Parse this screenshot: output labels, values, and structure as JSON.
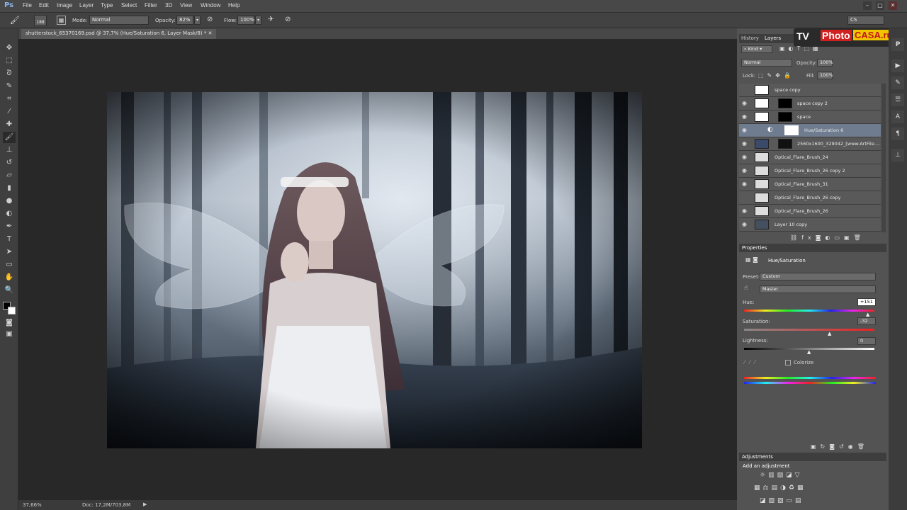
{
  "menubar": {
    "logo": "Ps",
    "items": [
      "File",
      "Edit",
      "Image",
      "Layer",
      "Type",
      "Select",
      "Filter",
      "3D",
      "View",
      "Window",
      "Help"
    ],
    "workspace": "CS"
  },
  "options": {
    "brush_size": "188",
    "mode_label": "Mode:",
    "mode_value": "Normal",
    "opacity_label": "Opacity:",
    "opacity_value": "82%",
    "flow_label": "Flow:",
    "flow_value": "100%"
  },
  "document": {
    "tab_title": "shutterstock_65370169.psd @ 37,7% (Hue/Saturation 6, Layer Mask/8) *",
    "zoom": "37,66%",
    "doc_info": "Doc: 17,2M/703,8M"
  },
  "watermark": {
    "tv": "TV",
    "photo": "Photo",
    "casa": "CASA.ru"
  },
  "layers_panel": {
    "tabs": [
      "History",
      "Layers"
    ],
    "kind": "Kind",
    "blend_mode": "Normal",
    "opacity_label": "Opacity:",
    "opacity_value": "100%",
    "lock_label": "Lock:",
    "fill_label": "Fill:",
    "fill_value": "100%",
    "layers": [
      {
        "name": "space copy",
        "visible": false
      },
      {
        "name": "space copy 2",
        "visible": true
      },
      {
        "name": "space",
        "visible": true
      },
      {
        "name": "Hue/Saturation 6",
        "visible": true,
        "selected": true
      },
      {
        "name": "2560x1600_329042_[www.ArtFile....",
        "visible": true
      },
      {
        "name": "Optical_Flare_Brush_24",
        "visible": true
      },
      {
        "name": "Optical_Flare_Brush_26 copy 2",
        "visible": true
      },
      {
        "name": "Optical_Flare_Brush_31",
        "visible": true
      },
      {
        "name": "Optical_Flare_Brush_26 copy",
        "visible": false
      },
      {
        "name": "Optical_Flare_Brush_26",
        "visible": true
      },
      {
        "name": "Layer 10 copy",
        "visible": true
      }
    ]
  },
  "properties": {
    "tab": "Properties",
    "title": "Hue/Saturation",
    "preset_label": "Preset:",
    "preset_value": "Custom",
    "channel": "Master",
    "hue_label": "Hue:",
    "hue_value": "+151",
    "saturation_label": "Saturation:",
    "saturation_value": "-32",
    "lightness_label": "Lightness:",
    "lightness_value": "0",
    "colorize_label": "Colorize"
  },
  "adjustments": {
    "tab": "Adjustments",
    "subtitle": "Add an adjustment"
  }
}
